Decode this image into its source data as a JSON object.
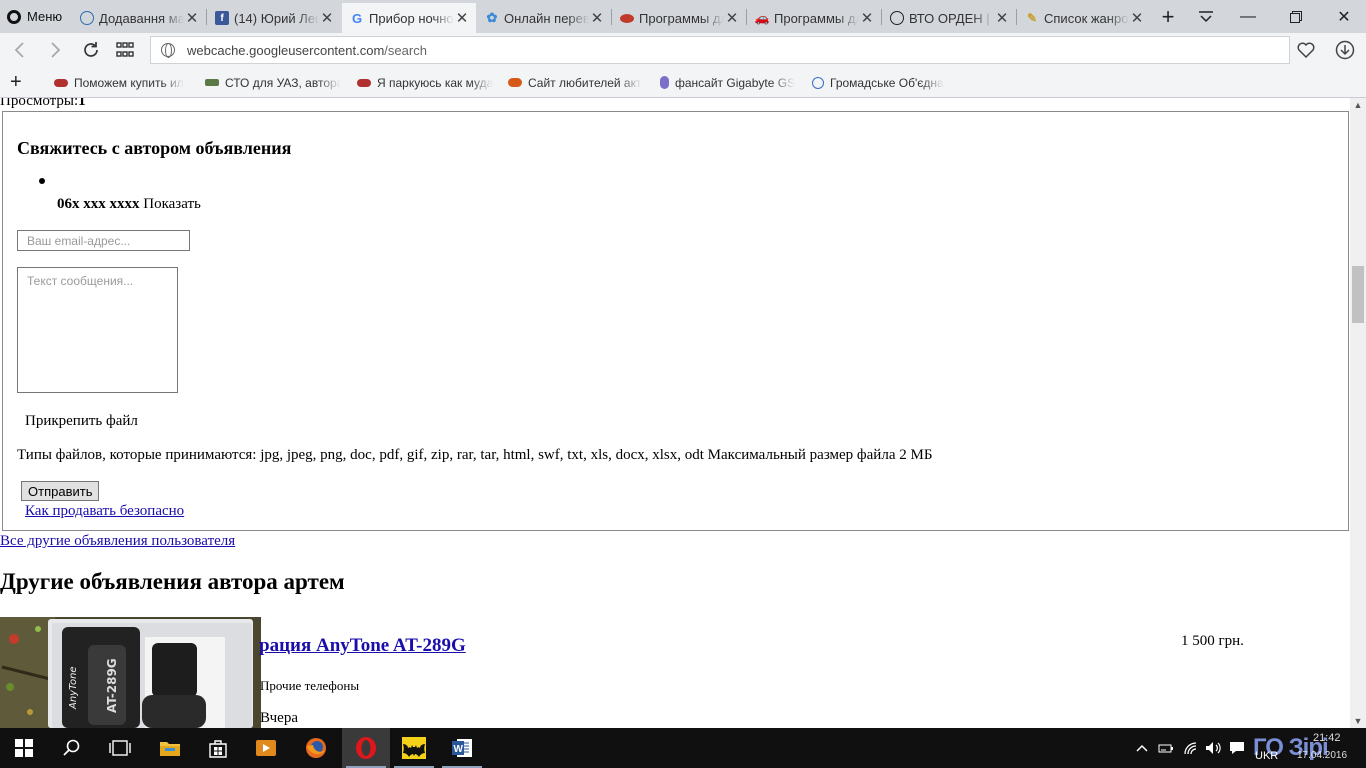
{
  "browser": {
    "menu_label": "Меню",
    "tabs": [
      {
        "title": "Додавання ма",
        "favicon": "ukrainian-site-icon",
        "active": false
      },
      {
        "title": "(14) Юрий Лец",
        "favicon": "facebook-icon",
        "active": false
      },
      {
        "title": "Прибор ночно",
        "favicon": "google-icon",
        "active": true
      },
      {
        "title": "Онлайн перев",
        "favicon": "translator-icon",
        "active": false
      },
      {
        "title": "Программы дл",
        "favicon": "auto-forum-icon",
        "active": false
      },
      {
        "title": "Программы дл",
        "favicon": "car-icon",
        "active": false
      },
      {
        "title": "ВТО ОРДЕН | В",
        "favicon": "vk-icon",
        "active": false
      },
      {
        "title": "Список жанро",
        "favicon": "pencil-icon",
        "active": false
      }
    ],
    "address": {
      "host": "webcache.googleusercontent.com",
      "path": "/search"
    },
    "bookmarks": [
      {
        "label": "Поможем купить ил",
        "icon": "car-icon"
      },
      {
        "label": "СТО для УАЗ, автора",
        "icon": "uaz-icon"
      },
      {
        "label": "Я паркуюсь как муда",
        "icon": "car-icon"
      },
      {
        "label": "Сайт любителей акт",
        "icon": "fish-icon"
      },
      {
        "label": "фансайт Gigabyte GS",
        "icon": "gigabyte-icon"
      },
      {
        "label": "Громадське Об'єдна",
        "icon": "ukraine-site-icon"
      }
    ]
  },
  "page": {
    "views_label": "Просмотры:",
    "views_count": "1",
    "contact": {
      "title": "Свяжитесь с автором объявления",
      "phone_masked": "06x xxx xxxx",
      "phone_show": "Показать",
      "email_placeholder": "Ваш email-адрес...",
      "message_placeholder": "Текст сообщения...",
      "attach_label": "Прикрепить файл",
      "file_types": "Типы файлов, которые принимаются: jpg, jpeg, png, doc, pdf, gif, zip, rar, tar, html, swf, txt, xls, docx, xlsx, odt Максимальный размер файла 2 МБ",
      "send_label": "Отправить",
      "safety_link": "Как продавать безопасно"
    },
    "all_ads_link": "Все другие объявления пользователя",
    "other_ads_title": "Другие объявления автора артем",
    "ads": [
      {
        "title": "рация AnyTone AT-289G",
        "price": "1 500 грн.",
        "category": "Прочие телефоны",
        "date": "Вчера",
        "image_text": "AnyTone",
        "image_model": "AT-289G"
      }
    ]
  },
  "taskbar": {
    "apps": [
      "file-explorer",
      "store",
      "media-player",
      "firefox",
      "opera",
      "batman-app",
      "word"
    ],
    "clock": {
      "overlay": "ГО Зірі",
      "lang": "UKR",
      "time": "21:42",
      "date": "17.04.2016"
    }
  },
  "colors": {
    "link": "#1a0dab",
    "tabbar": "#d3d7dc",
    "taskbar": "#101010"
  }
}
